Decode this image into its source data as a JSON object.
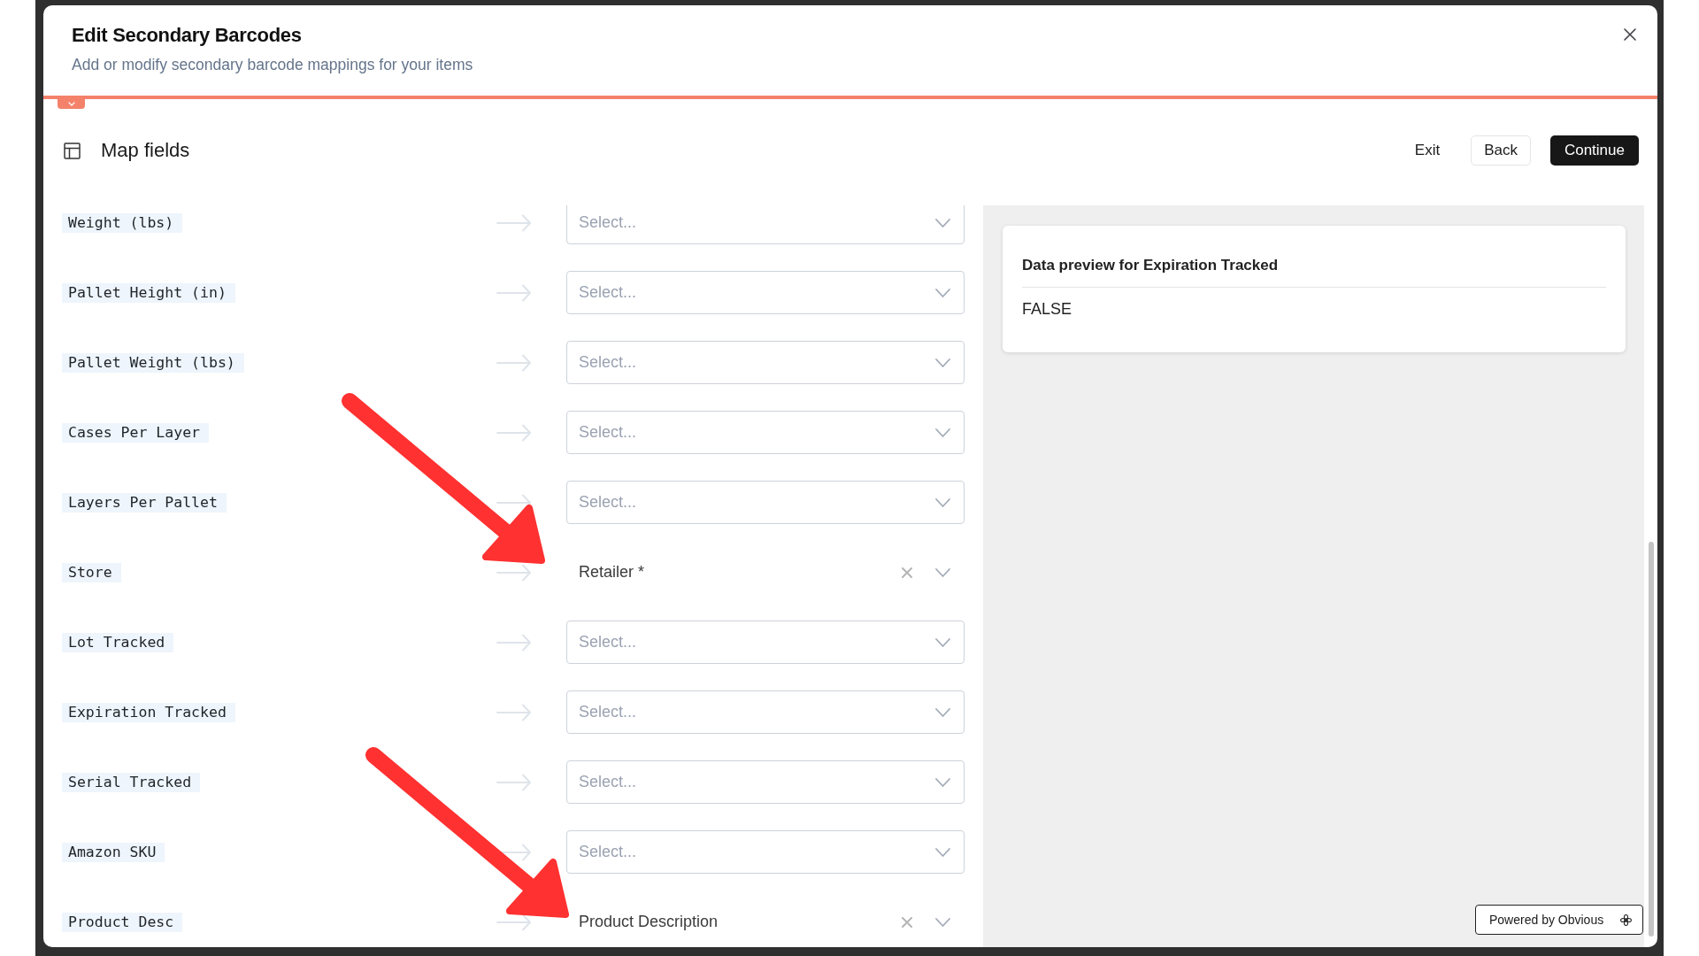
{
  "dialog": {
    "title": "Edit Secondary Barcodes",
    "subtitle": "Add or modify secondary barcode mappings for your items"
  },
  "step": {
    "title": "Map fields",
    "actions": [
      {
        "label": "Exit",
        "kind": "text"
      },
      {
        "label": "Back",
        "kind": "outline"
      },
      {
        "label": "Continue",
        "kind": "primary"
      }
    ]
  },
  "mappings": [
    {
      "field": "Weight (lbs)",
      "placeholder": "Select..."
    },
    {
      "field": "Pallet Height (in)",
      "placeholder": "Select..."
    },
    {
      "field": "Pallet Weight (lbs)",
      "placeholder": "Select..."
    },
    {
      "field": "Cases Per Layer",
      "placeholder": "Select..."
    },
    {
      "field": "Layers Per Pallet",
      "placeholder": "Select..."
    },
    {
      "field": "Store",
      "value": "Retailer *"
    },
    {
      "field": "Lot Tracked",
      "placeholder": "Select..."
    },
    {
      "field": "Expiration Tracked",
      "placeholder": "Select..."
    },
    {
      "field": "Serial Tracked",
      "placeholder": "Select..."
    },
    {
      "field": "Amazon SKU",
      "placeholder": "Select..."
    },
    {
      "field": "Product Desc",
      "value": "Product Description"
    }
  ],
  "preview": {
    "title": "Data preview for Expiration Tracked",
    "value": "FALSE"
  },
  "footer_badge": {
    "label": "Powered by Obvious"
  }
}
